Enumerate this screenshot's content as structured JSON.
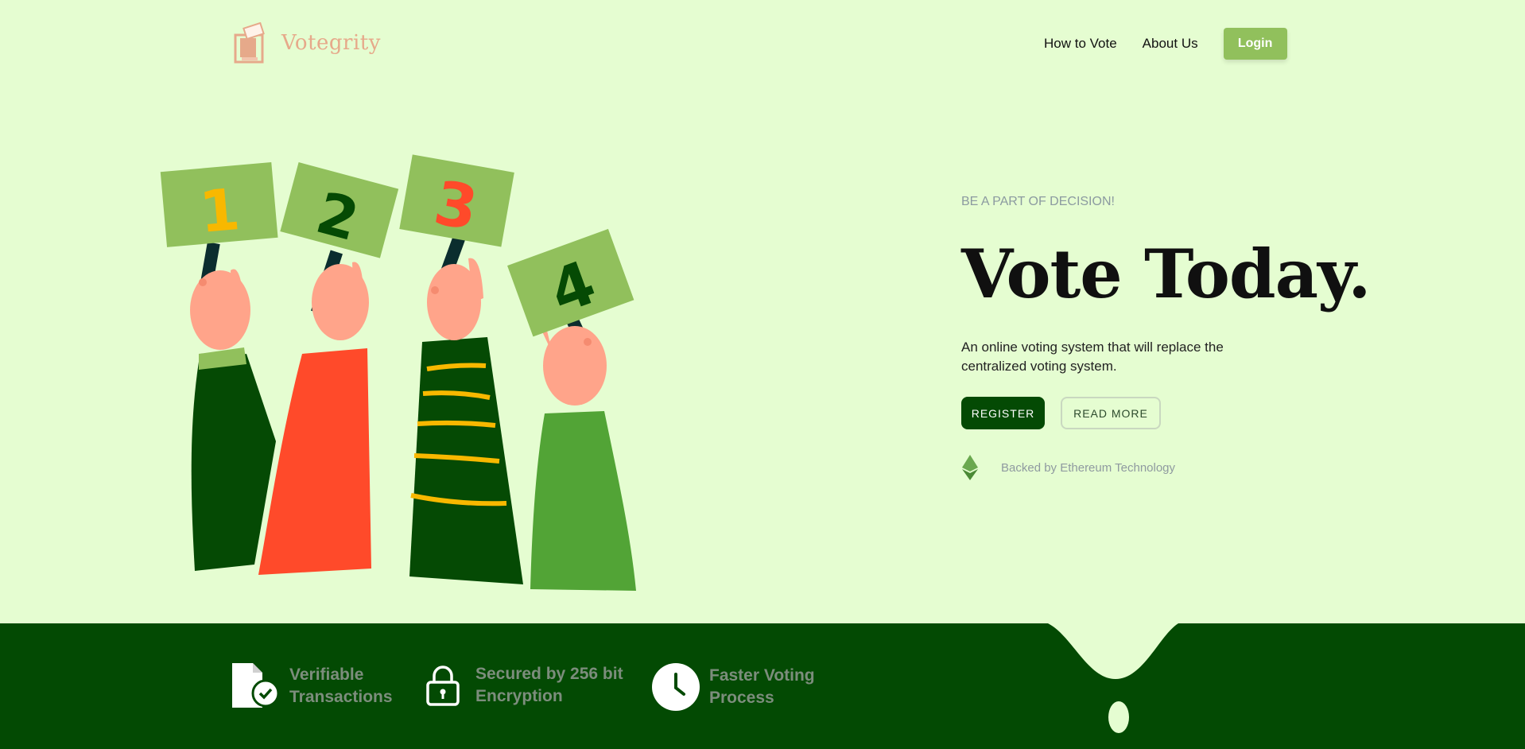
{
  "brand": {
    "name": "Votegrity",
    "logo_icon": "ballot-box-icon",
    "color": "#e6a98a"
  },
  "nav": {
    "items": [
      {
        "label": "How to Vote"
      },
      {
        "label": "About Us"
      }
    ],
    "login_label": "Login"
  },
  "hero": {
    "tagline": "BE A PART OF DECISION!",
    "headline": "Vote Today.",
    "description": "An online voting system that will replace the centralized voting system.",
    "register_label": "REGISTER",
    "read_more_label": "READ MORE",
    "backed_text": "Backed by Ethereum Technology",
    "backed_icon": "ethereum-icon"
  },
  "illustration": {
    "signs": [
      "1",
      "2",
      "3",
      "4"
    ]
  },
  "features": [
    {
      "line1": "Verifiable",
      "line2": "Transactions",
      "icon": "verified-document-icon"
    },
    {
      "line1": "Secured by 256 bit",
      "line2": "Encryption",
      "icon": "lock-icon"
    },
    {
      "line1": "Faster Voting",
      "line2": "Process",
      "icon": "clock-icon"
    }
  ],
  "colors": {
    "background": "#e5fdd1",
    "dark_green": "#034a03",
    "accent_green": "#91c05c",
    "red": "#ff4a2a",
    "yellow": "#f8b800"
  }
}
